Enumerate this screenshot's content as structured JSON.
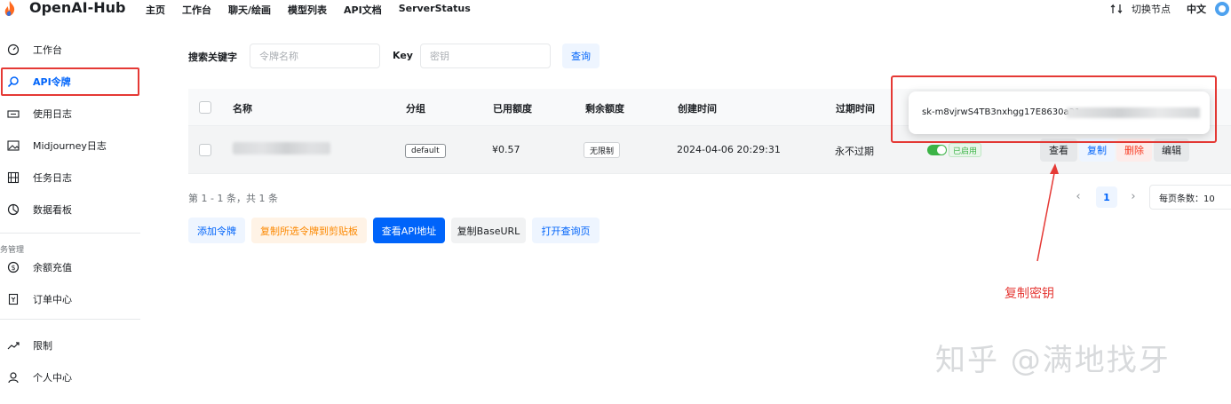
{
  "header": {
    "brand": "OpenAI-Hub",
    "nav": [
      "主页",
      "工作台",
      "聊天/绘画",
      "模型列表",
      "API文档",
      "ServerStatus"
    ],
    "switch_node": "切换节点",
    "language": "中文"
  },
  "sidebar": {
    "items": [
      {
        "label": "工作台",
        "icon": "dashboard-icon"
      },
      {
        "label": "API令牌",
        "icon": "search-icon"
      },
      {
        "label": "使用日志",
        "icon": "ticket-icon"
      },
      {
        "label": "Midjourney日志",
        "icon": "image-icon"
      },
      {
        "label": "任务日志",
        "icon": "film-icon"
      },
      {
        "label": "数据看板",
        "icon": "pie-icon"
      },
      {
        "label": "余额充值",
        "icon": "coin-icon"
      },
      {
        "label": "订单中心",
        "icon": "receipt-icon"
      },
      {
        "label": "限制",
        "icon": "trend-icon"
      },
      {
        "label": "个人中心",
        "icon": "user-icon"
      }
    ],
    "group_label": "务管理",
    "active": "API令牌"
  },
  "search": {
    "keyword_label": "搜索关键字",
    "keyword_placeholder": "令牌名称",
    "key_label": "Key",
    "key_placeholder": "密钥",
    "query_button": "查询"
  },
  "table": {
    "columns": [
      "名称",
      "分组",
      "已用额度",
      "剩余额度",
      "创建时间",
      "过期时间"
    ],
    "row": {
      "group": "default",
      "used": "¥0.57",
      "remaining": "无限制",
      "created": "2024-04-06 20:29:31",
      "expires": "永不过期",
      "status": "已启用",
      "actions": [
        "查看",
        "复制",
        "删除",
        "编辑"
      ]
    }
  },
  "popover": {
    "key_text": "sk-m8vjrwS4TB3nxhgg17E8630a21"
  },
  "pagination": {
    "info": "第 1 - 1 条，共 1 条",
    "current_page": "1",
    "page_size": "每页条数：10"
  },
  "buttons": {
    "add_token": "添加令牌",
    "copy_selected": "复制所选令牌到剪贴板",
    "view_api": "查看API地址",
    "copy_base_url": "复制BaseURL",
    "open_query": "打开查询页"
  },
  "annotation": {
    "label": "复制密钥"
  },
  "watermark": "知乎 @满地找牙",
  "colors": {
    "primary": "#0064fa",
    "annotation_red": "#e53935",
    "success": "#3bb346",
    "danger": "#f93920",
    "warning": "#fc8800"
  }
}
